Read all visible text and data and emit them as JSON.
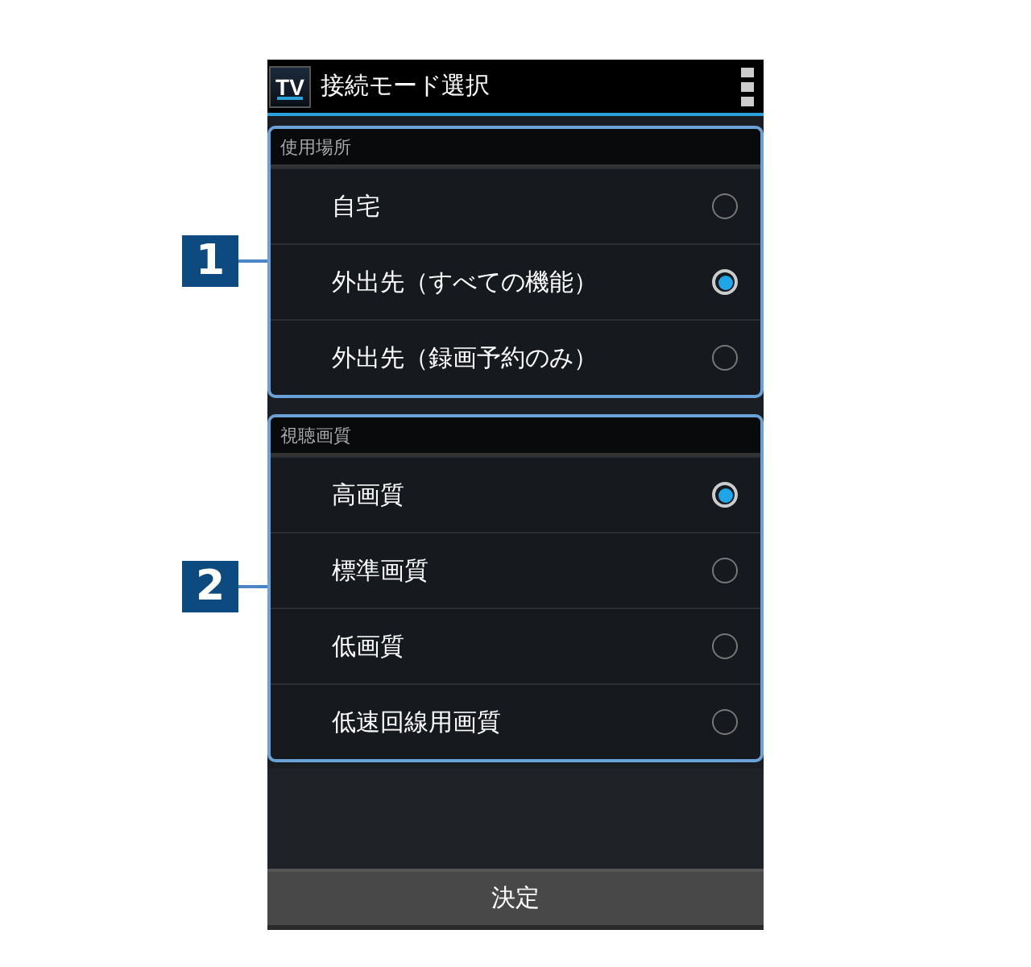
{
  "app_bar": {
    "logo_text": "TV",
    "title": "接続モード選択"
  },
  "sections": [
    {
      "callout": "1",
      "heading": "使用場所",
      "options": [
        {
          "label": "自宅",
          "selected": false
        },
        {
          "label": "外出先（すべての機能）",
          "selected": true
        },
        {
          "label": "外出先（録画予約のみ）",
          "selected": false
        }
      ]
    },
    {
      "callout": "2",
      "heading": "視聴画質",
      "options": [
        {
          "label": "高画質",
          "selected": true
        },
        {
          "label": "標準画質",
          "selected": false
        },
        {
          "label": "低画質",
          "selected": false
        },
        {
          "label": "低速回線用画質",
          "selected": false
        }
      ]
    }
  ],
  "confirm_button": "決定"
}
